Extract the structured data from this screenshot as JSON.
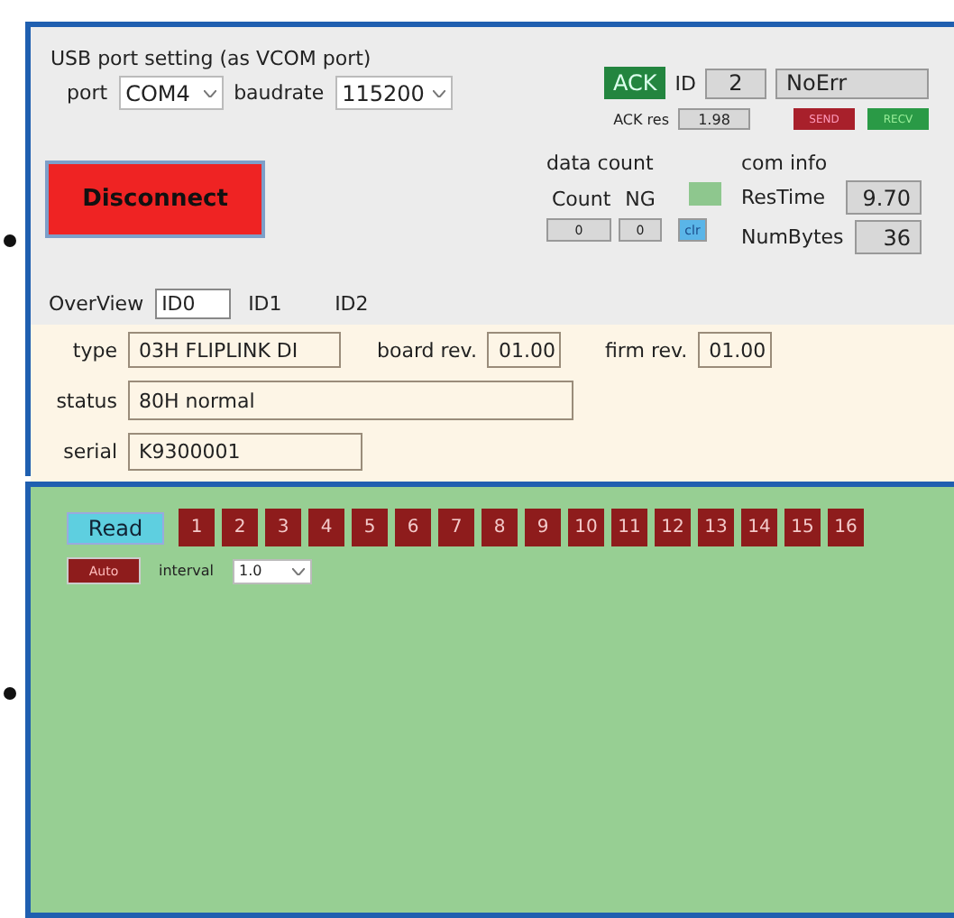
{
  "usb_port_setting": {
    "title": "USB port setting (as VCOM port)",
    "port_label": "port",
    "port": "COM4",
    "baudrate_label": "baudrate",
    "baudrate": "115200"
  },
  "disconnect_button": "Disconnect",
  "ack": {
    "ack_label": "ACK",
    "id_label": "ID",
    "id": "2",
    "error": "NoErr",
    "ack_res_label": "ACK res",
    "ack_res": "1.98",
    "send": "SEND",
    "recv": "RECV"
  },
  "data_count": {
    "title": "data count",
    "count_label": "Count",
    "ng_label": "NG",
    "count": "0",
    "ng": "0",
    "clear": "clr"
  },
  "com_info": {
    "title": "com info",
    "rows": [
      {
        "label": "ResTime",
        "value": "9.70"
      },
      {
        "label": "NumBytes",
        "value": "36"
      }
    ]
  },
  "overview": {
    "label": "OverView",
    "tabs": [
      {
        "label": "ID0",
        "selected": true
      },
      {
        "label": "ID1",
        "selected": false
      },
      {
        "label": "ID2",
        "selected": false
      }
    ]
  },
  "details": {
    "type_label": "type",
    "type": "03H FLIPLINK DI",
    "board_rev_label": "board rev.",
    "board_rev": "01.00",
    "firm_rev_label": "firm rev.",
    "firm_rev": "01.00",
    "status_label": "status",
    "status": "80H normal",
    "serial_label": "serial",
    "serial": "K9300001"
  },
  "read_panel": {
    "read": "Read",
    "ids": [
      "1",
      "2",
      "3",
      "4",
      "5",
      "6",
      "7",
      "8",
      "9",
      "10",
      "11",
      "12",
      "13",
      "14",
      "15",
      "16"
    ],
    "auto": "Auto",
    "interval_label": "interval",
    "interval": "1.0"
  }
}
